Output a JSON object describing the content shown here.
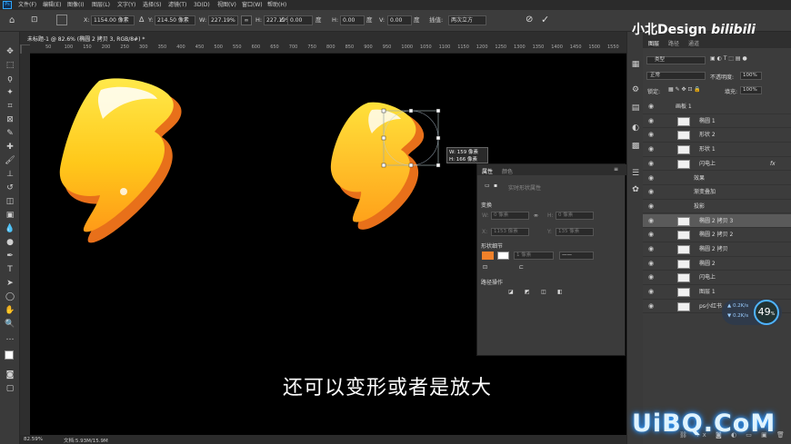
{
  "app": {
    "logo": "Ps"
  },
  "menu": [
    "文件(F)",
    "编辑(E)",
    "图像(I)",
    "图层(L)",
    "文字(Y)",
    "选择(S)",
    "滤镜(T)",
    "3D(D)",
    "视图(V)",
    "窗口(W)",
    "帮助(H)"
  ],
  "options": {
    "x_label": "X:",
    "x_value": "1154.00 像素",
    "y_label": "Y:",
    "y_value": "214.50 像素",
    "w_label": "W:",
    "w_value": "227.19%",
    "h_label": "H:",
    "h_value": "227.19%",
    "angle_value": "0.00",
    "angle_unit": "度",
    "hskew_label": "H:",
    "hskew_value": "0.00",
    "hskew_unit": "度",
    "vskew_label": "V:",
    "vskew_value": "0.00",
    "vskew_unit": "度",
    "interp_label": "插值:",
    "interp_value": "两次立方"
  },
  "document": {
    "tab_title": "未标题-1 @ 82.6% (椭圆 2 拷贝 3, RGB/8#) *",
    "zoom": "82.59%",
    "doc_info": "文档:5.93M/15.9M"
  },
  "ruler": [
    "50",
    "100",
    "150",
    "200",
    "250",
    "300",
    "350",
    "400",
    "450",
    "500",
    "550",
    "600",
    "650",
    "700",
    "750",
    "800",
    "850",
    "900",
    "950",
    "1000",
    "1050",
    "1100",
    "1150",
    "1200",
    "1250",
    "1300",
    "1350",
    "1400",
    "1450",
    "1500",
    "1550"
  ],
  "transform_tooltip": {
    "w": "W: 159 像素",
    "h": "H: 166 像素"
  },
  "subtitle": "还可以变形或者是放大",
  "brand": "小北Design",
  "brand_suffix": "bilibili",
  "watermark": "UiBQ.CoM",
  "layers_panel": {
    "tabs": [
      "图层",
      "路径",
      "通道"
    ],
    "filter_label": "类型",
    "blend_mode": "正常",
    "opacity_label": "不透明度:",
    "opacity_value": "100%",
    "lock_label": "锁定:",
    "fill_label": "填充:",
    "fill_value": "100%"
  },
  "layers": [
    {
      "name": "画板 1",
      "type": "artboard"
    },
    {
      "name": "椭圆 1",
      "type": "layer"
    },
    {
      "name": "形状 2",
      "type": "layer"
    },
    {
      "name": "形状 1",
      "type": "layer"
    },
    {
      "name": "闪电上",
      "type": "layer",
      "fx": "fx"
    },
    {
      "name": "效果",
      "type": "effect"
    },
    {
      "name": "渐变叠加",
      "type": "effect"
    },
    {
      "name": "投影",
      "type": "effect"
    },
    {
      "name": "椭圆 2 拷贝 3",
      "type": "layer",
      "selected": true
    },
    {
      "name": "椭圆 2 拷贝 2",
      "type": "layer"
    },
    {
      "name": "椭圆 2 拷贝",
      "type": "layer"
    },
    {
      "name": "椭圆 2",
      "type": "layer"
    },
    {
      "name": "闪电上",
      "type": "layer"
    },
    {
      "name": "图层 1",
      "type": "layer"
    },
    {
      "name": "ps小红书",
      "type": "layer"
    }
  ],
  "properties": {
    "tabs": [
      "属性",
      "颜色"
    ],
    "title": "实时形状属性",
    "section_transform": "变换",
    "w_lbl": "W:",
    "w_ph": "0 像素",
    "h_lbl": "H:",
    "h_ph": "0 像素",
    "x_lbl": "X:",
    "x_ph": "1153 像素",
    "y_lbl": "Y:",
    "y_ph": "135 像素",
    "section_shape": "形状细节",
    "stroke_ph": "1 像素",
    "section_path": "路径操作"
  },
  "perf": {
    "percent": "49",
    "unit": "%",
    "up": "0.2",
    "down": "0.2",
    "rate_unit": "K/s"
  },
  "colors": {
    "fg": "#ffffff",
    "bg": "#000000",
    "accent": "#f0812a"
  }
}
